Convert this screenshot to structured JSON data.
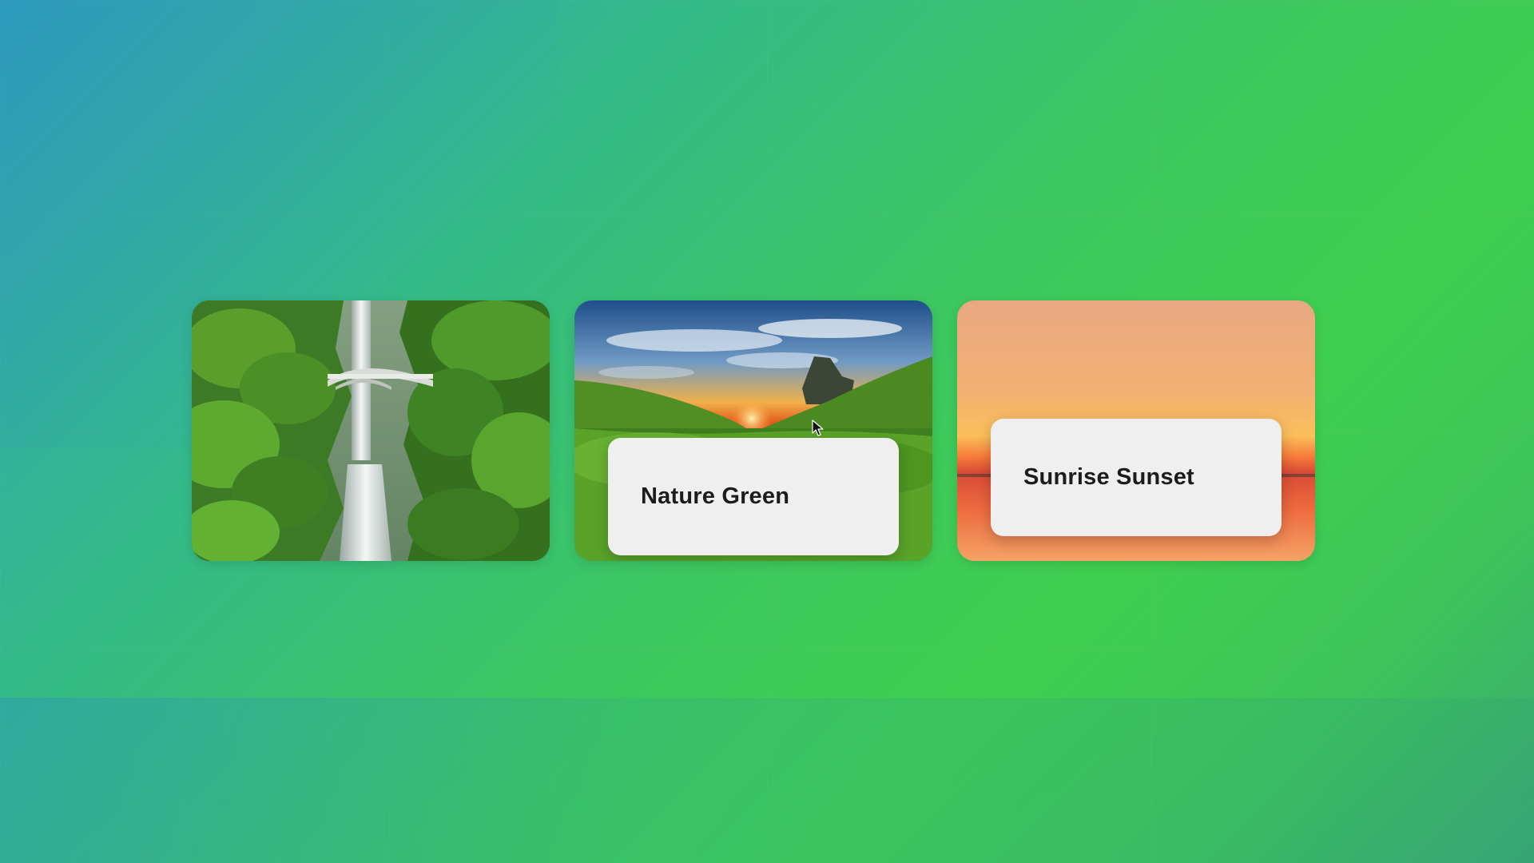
{
  "background": {
    "colors": [
      "#2fa3b8",
      "#34b98a",
      "#3cc760",
      "#3fcf4f",
      "#3aa874"
    ]
  },
  "cards": [
    {
      "id": "waterfall",
      "image": "waterfall-forest-bridge",
      "caption": null
    },
    {
      "id": "nature",
      "image": "green-valley-sunset-sky",
      "caption": "Nature Green"
    },
    {
      "id": "sunrise",
      "image": "orange-sunset-horizon",
      "caption": "Sunrise Sunset"
    }
  ],
  "icons": {
    "cursor": "mouse-pointer-icon"
  }
}
